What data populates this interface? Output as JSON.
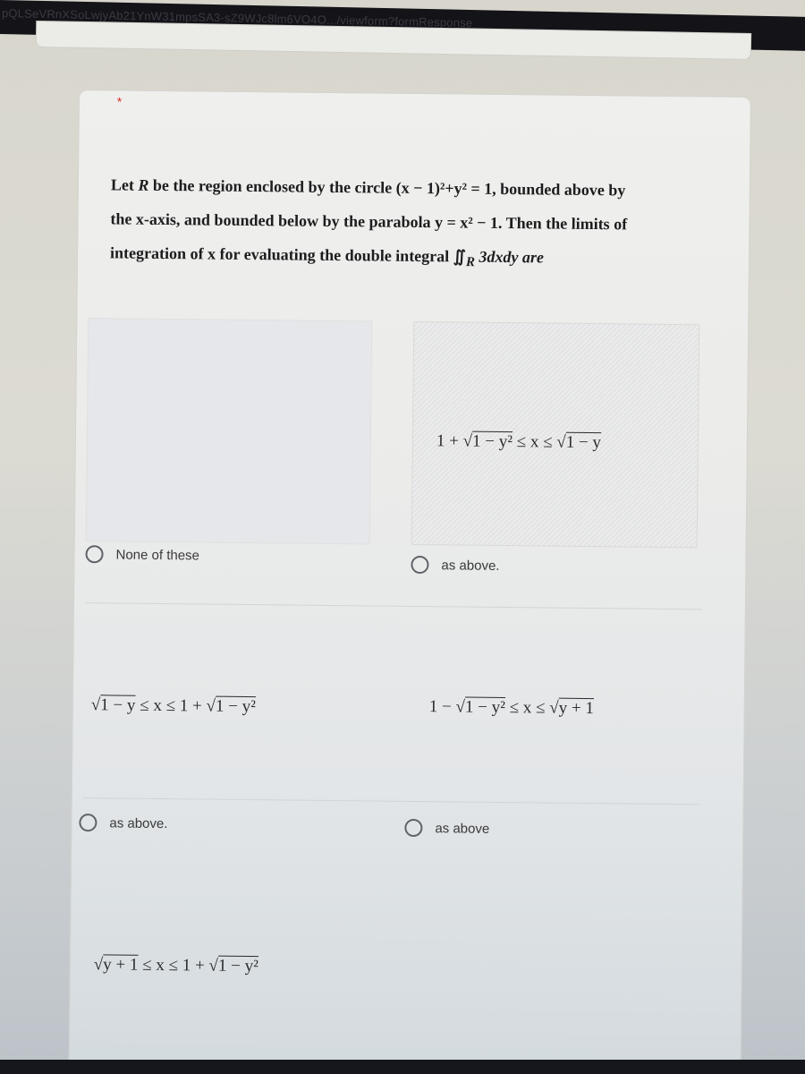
{
  "browser": {
    "url_fragment": "pQLSeVRnXSoLwjyAb21YnW31mpsSA3-sZ9WJc8lm6VO4O.../viewform?formResponse"
  },
  "question": {
    "required_marker": "*",
    "text_before_R": "Let ",
    "R": "R",
    "text_line1": " be the region enclosed by the circle (x − 1)²+y² = 1, bounded above by",
    "text_line2": "the x-axis, and bounded below by the parabola y = x² − 1. Then the limits of",
    "text_line3": "integration of x for evaluating the double integral ∬",
    "integral_sub": "R",
    "text_line3_end": " 3dxdy are"
  },
  "options": [
    {
      "id": "opt-1",
      "image_formula": "",
      "label": "None of these",
      "selected": false
    },
    {
      "id": "opt-2",
      "image_formula": "1 + √(1 − y²) ≤ x ≤ √(1 − y)",
      "formula_parts": {
        "a": "1 + √",
        "b": "1 − y²",
        "c": " ≤ x ≤ √",
        "d": "1 − y"
      },
      "label": "as above.",
      "selected": false
    },
    {
      "id": "opt-3",
      "image_formula": "√(1 − y) ≤ x ≤ 1 + √(1 − y²)",
      "formula_parts": {
        "a": "√",
        "b": "1 − y",
        "c": " ≤ x ≤ 1 + √",
        "d": "1 − y²"
      },
      "label": "as above.",
      "selected": false
    },
    {
      "id": "opt-4",
      "image_formula": "1 − √(1 − y²) ≤ x ≤ √(y + 1)",
      "formula_parts": {
        "a": "1 − √",
        "b": "1 − y²",
        "c": " ≤ x ≤ √",
        "d": "y + 1"
      },
      "label": "as above",
      "selected": false
    },
    {
      "id": "opt-5",
      "image_formula": "√(y + 1) ≤ x ≤ 1 + √(1 − y²)",
      "formula_parts": {
        "a": "√",
        "b": "y + 1",
        "c": " ≤ x ≤ 1 + √",
        "d": "1 − y²"
      },
      "label": "",
      "selected": false
    }
  ],
  "colors": {
    "required": "#d93025",
    "radio_border": "#5f6368"
  }
}
